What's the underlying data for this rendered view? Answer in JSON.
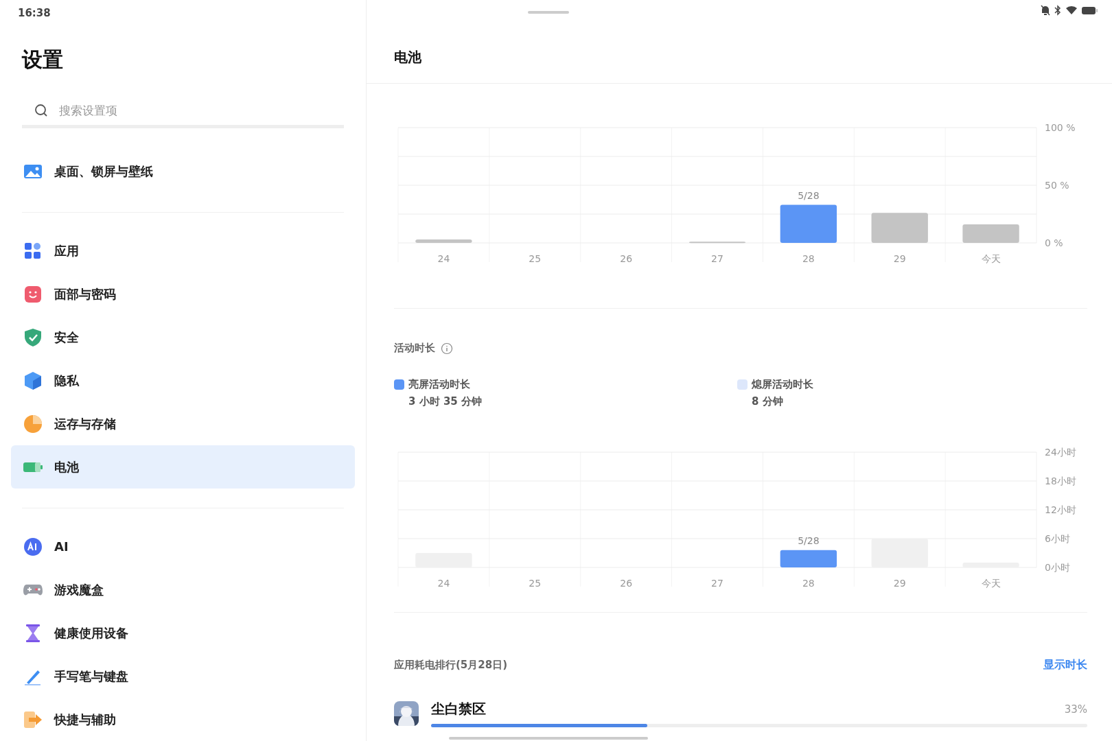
{
  "status_bar": {
    "time": "16:38"
  },
  "sidebar": {
    "title": "设置",
    "search": {
      "placeholder": "搜索设置项"
    },
    "groups": [
      {
        "items": [
          {
            "label": "桌面、锁屏与壁纸",
            "selected": false
          }
        ]
      },
      {
        "items": [
          {
            "label": "应用",
            "selected": false
          },
          {
            "label": "面部与密码",
            "selected": false
          },
          {
            "label": "安全",
            "selected": false
          },
          {
            "label": "隐私",
            "selected": false
          },
          {
            "label": "运存与存储",
            "selected": false
          },
          {
            "label": "电池",
            "selected": true
          }
        ]
      },
      {
        "items": [
          {
            "label": "AI",
            "selected": false
          },
          {
            "label": "游戏魔盒",
            "selected": false
          },
          {
            "label": "健康使用设备",
            "selected": false
          },
          {
            "label": "手写笔与键盘",
            "selected": false
          },
          {
            "label": "快捷与辅助",
            "selected": false
          }
        ]
      }
    ]
  },
  "content": {
    "title": "电池",
    "battery_chart": {
      "chart_data": {
        "type": "bar",
        "categories": [
          "24",
          "25",
          "26",
          "27",
          "28",
          "29",
          "今天"
        ],
        "series": [
          {
            "color": "#5b95f5",
            "values": [
              null,
              null,
              null,
              null,
              33,
              null,
              null
            ]
          },
          {
            "color": "#c4c4c4",
            "values": [
              3,
              0,
              0,
              1,
              null,
              26,
              16
            ]
          }
        ],
        "ylim": [
          0,
          100
        ],
        "yticks": [
          {
            "value": 0,
            "label": "0 %"
          },
          {
            "value": 50,
            "label": "50 %"
          },
          {
            "value": 100,
            "label": "100 %"
          }
        ],
        "grid": true,
        "annotations": [
          "5/28"
        ]
      }
    },
    "activity": {
      "title": "活动时长",
      "legend": [
        {
          "label": "亮屏活动时长",
          "value": "3 小时 35 分钟",
          "color": "#5b95f5"
        },
        {
          "label": "熄屏活动时长",
          "value": "8 分钟",
          "color": "#dde7fb"
        }
      ],
      "chart_data": {
        "type": "bar",
        "categories": [
          "24",
          "25",
          "26",
          "27",
          "28",
          "29",
          "今天"
        ],
        "series": [
          {
            "color": "#5b95f5",
            "values": [
              null,
              null,
              null,
              null,
              3.6,
              null,
              null
            ]
          },
          {
            "color": "#f0f0f0",
            "values": [
              3,
              0,
              0,
              0,
              null,
              6,
              1
            ]
          }
        ],
        "ylim": [
          0,
          24
        ],
        "yticks": [
          {
            "value": 0,
            "label": "0小时"
          },
          {
            "value": 6,
            "label": "6小时"
          },
          {
            "value": 12,
            "label": "12小时"
          },
          {
            "value": 18,
            "label": "18小时"
          },
          {
            "value": 24,
            "label": "24小时"
          }
        ],
        "grid": true,
        "annotations": [
          "5/28"
        ]
      }
    },
    "ranking": {
      "title": "应用耗电排行(5月28日)",
      "toggle": "显示时长",
      "apps": [
        {
          "name": "尘白禁区",
          "percent": "33%",
          "level": 0.33
        }
      ]
    }
  }
}
